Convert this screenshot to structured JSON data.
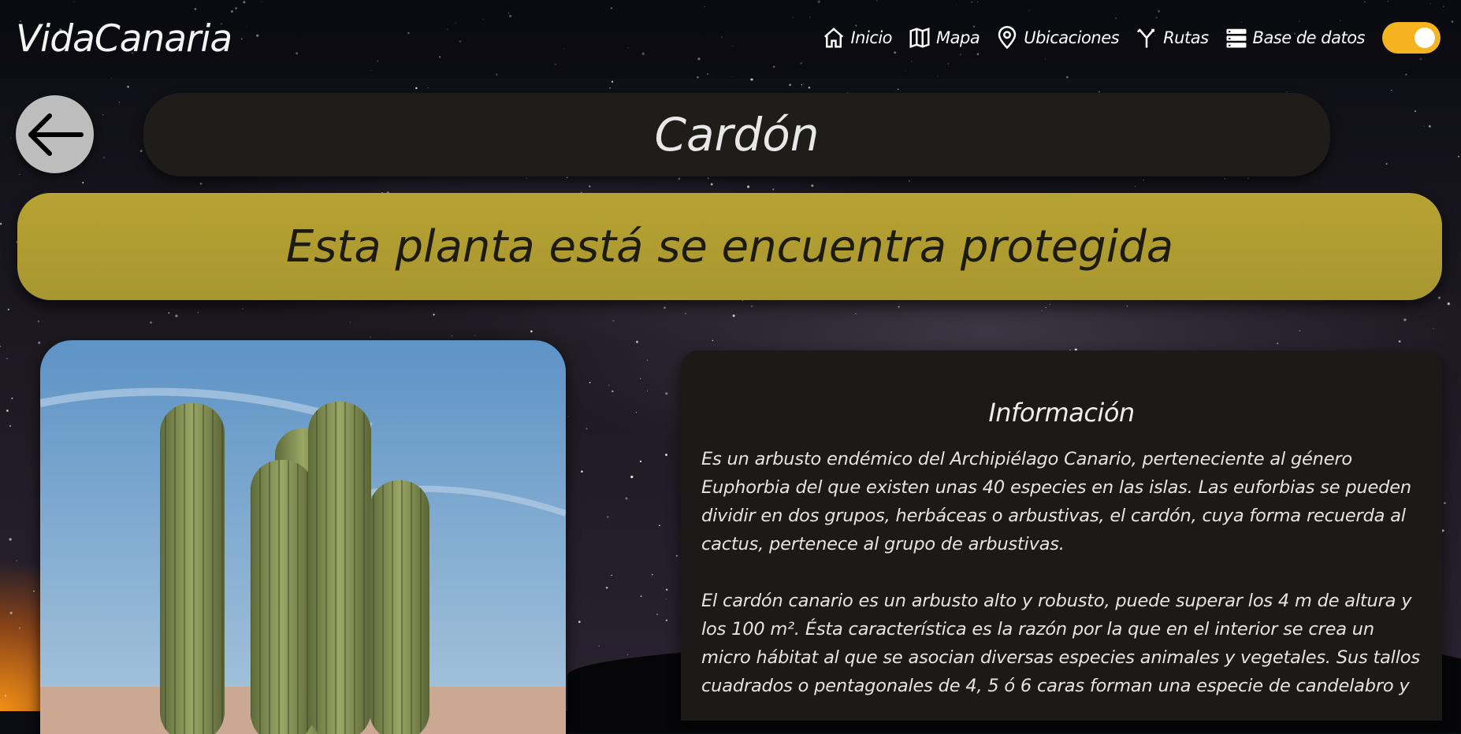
{
  "brand": "VidaCanaria",
  "nav": [
    {
      "label": "Inicio",
      "icon": "home-icon"
    },
    {
      "label": "Mapa",
      "icon": "map-icon"
    },
    {
      "label": "Ubicaciones",
      "icon": "location-pin-icon"
    },
    {
      "label": "Rutas",
      "icon": "route-fork-icon"
    },
    {
      "label": "Base de datos",
      "icon": "database-list-icon"
    }
  ],
  "theme_toggle": {
    "on": true,
    "color": "#f6b320"
  },
  "back_icon": "arrow-left-icon",
  "plant": {
    "name": "Cardón",
    "protected_notice": "Esta planta está se encuentra protegida",
    "info_title": "Información",
    "paragraphs": [
      "Es un arbusto endémico del Archipiélago Canario, perteneciente al género Euphorbia del que existen unas 40 especies en las islas. Las euforbias se pueden dividir en dos grupos, herbáceas o arbustivas, el cardón, cuya forma recuerda al cactus, pertenece al grupo de arbustivas.",
      "El cardón canario es un arbusto alto y robusto, puede superar los 4 m de altura y los 100 m². Ésta característica es la razón por la que en el interior se crea un micro hábitat al que se asocian diversas especies animales y vegetales. Sus tallos cuadrados o pentagonales de 4, 5 ó 6 caras forman una especie de candelabro y"
    ]
  },
  "colors": {
    "banner": "#b7a332",
    "card": "#1c1a18",
    "title_box": "#1e1d1a"
  }
}
